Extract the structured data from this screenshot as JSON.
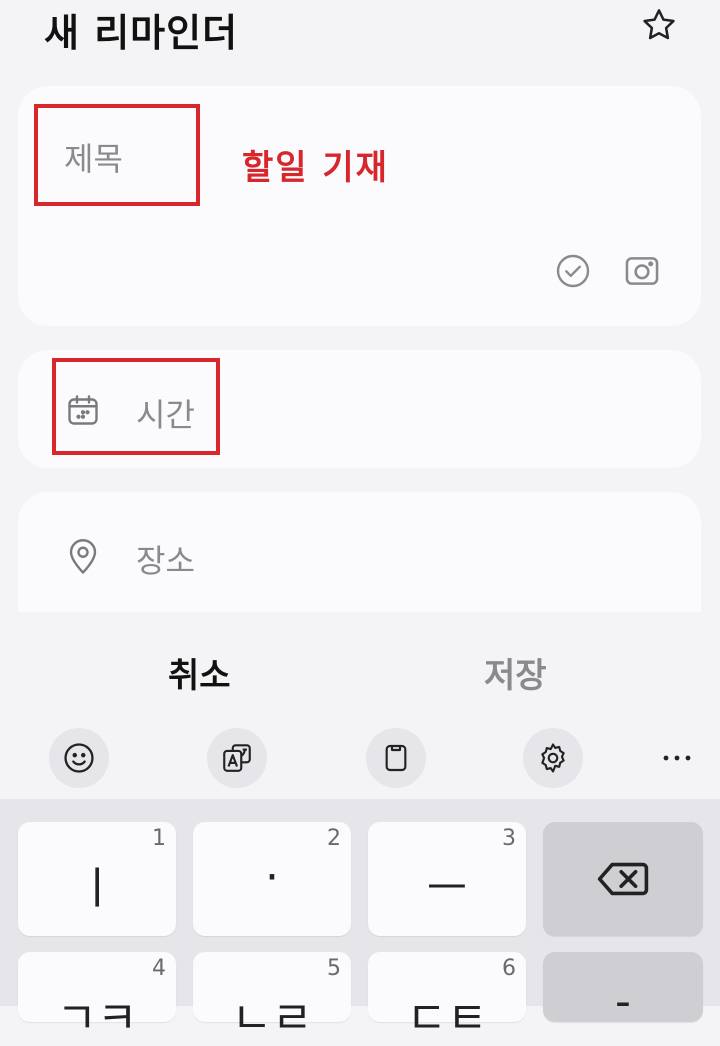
{
  "header": {
    "title": "새 리마인더",
    "favorite_icon": "star-icon"
  },
  "title_card": {
    "placeholder": "제목",
    "annotation": "할일 기재",
    "annotation_color": "#d8262d",
    "actions": [
      "check-circle-icon",
      "camera-icon"
    ]
  },
  "time_card": {
    "icon": "calendar-icon",
    "label": "시간"
  },
  "place_card": {
    "icon": "location-pin-icon",
    "label": "장소"
  },
  "actions": {
    "cancel_label": "취소",
    "save_label": "저장"
  },
  "keyboard_toolbar": [
    "emoji-icon",
    "translate-icon",
    "clipboard-icon",
    "settings-icon",
    "more-icon"
  ],
  "keyboard": {
    "row1": [
      {
        "glyph": "ㅣ",
        "number": "1"
      },
      {
        "glyph": "·",
        "number": "2"
      },
      {
        "glyph": "ㅡ",
        "number": "3"
      },
      {
        "glyph": "backspace-icon"
      }
    ],
    "row2": [
      {
        "glyph": "ㄱㅋ",
        "number": "4"
      },
      {
        "glyph": "ㄴㄹ",
        "number": "5"
      },
      {
        "glyph": "ㄷㅌ",
        "number": "6"
      },
      {
        "glyph": "-"
      }
    ]
  }
}
